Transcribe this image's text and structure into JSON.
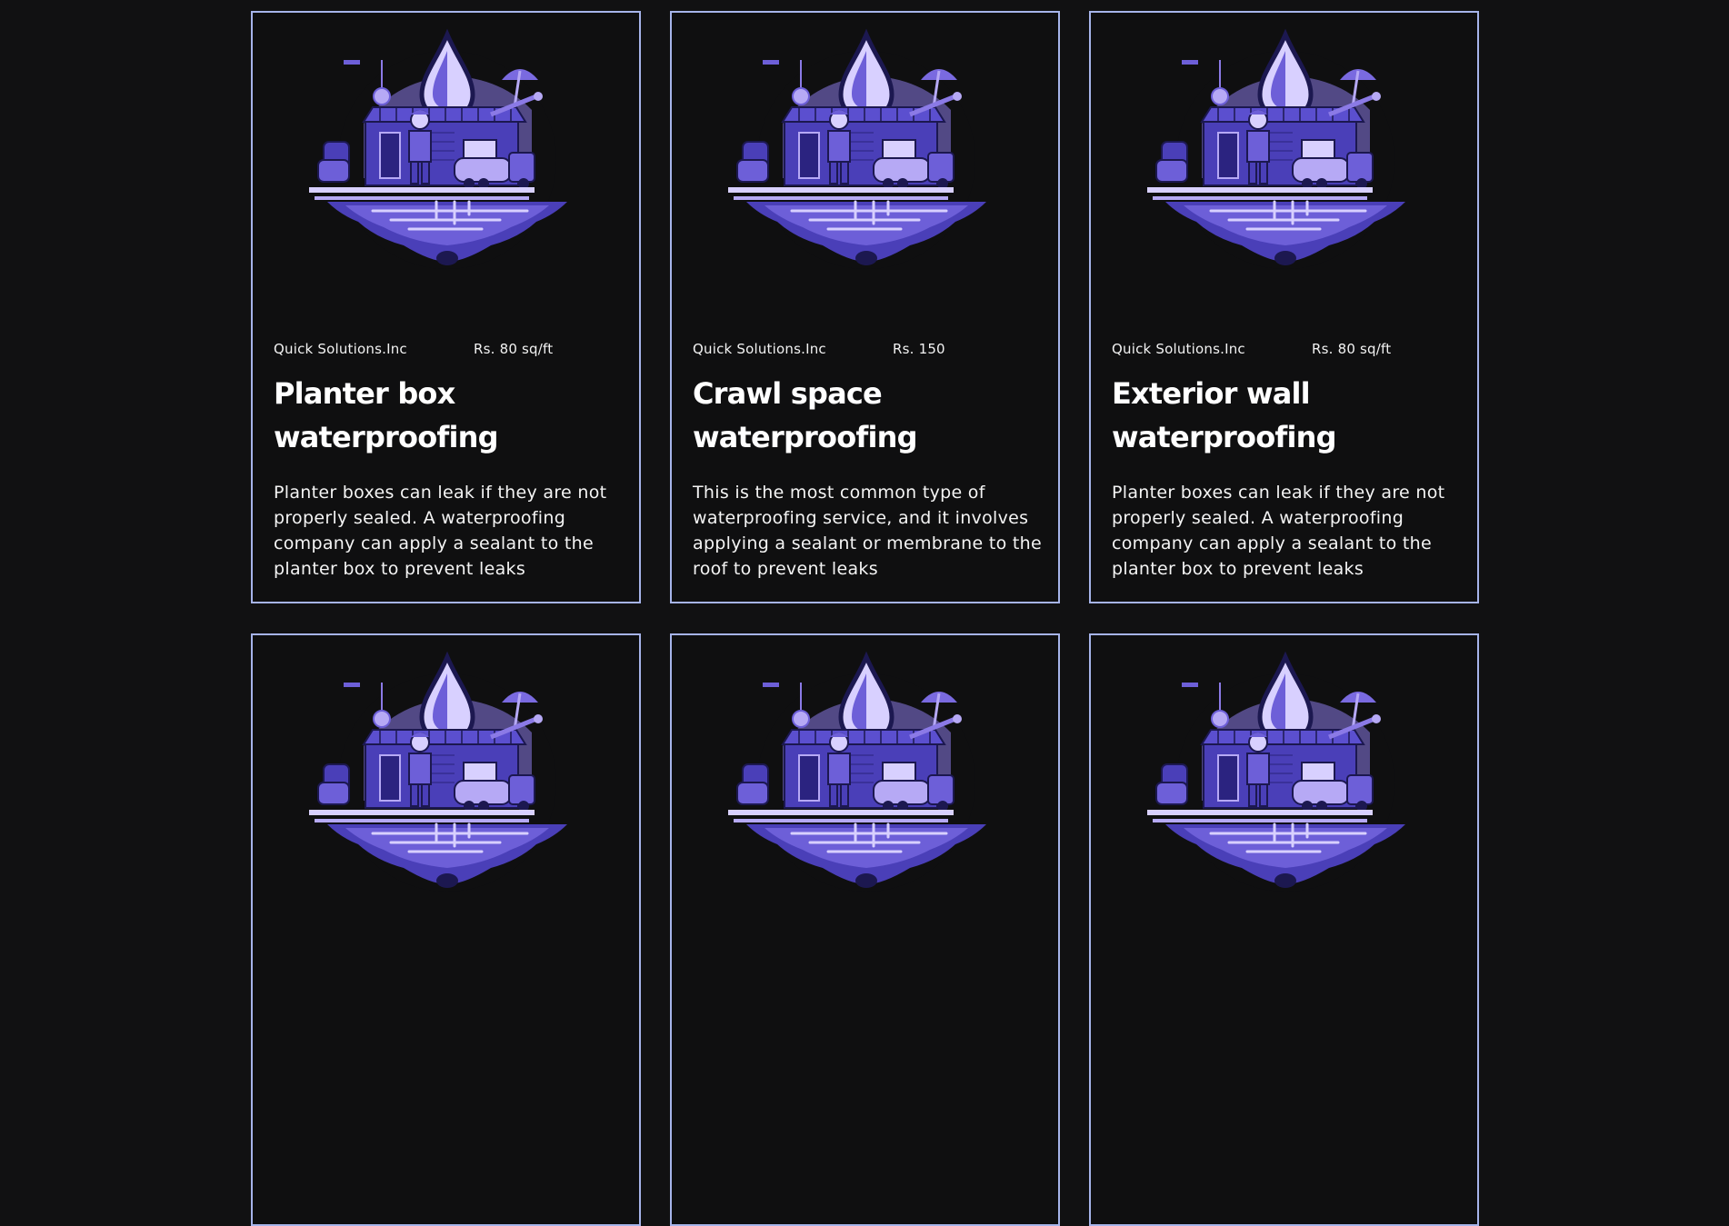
{
  "colors": {
    "background": "#111112",
    "card_border": "#a6b4ea",
    "illustration_primary": "#6d5fd8",
    "illustration_light": "#b6a9f5",
    "illustration_dark": "#1c1850"
  },
  "illustration_icon": "waterproofing-house-icon",
  "cards": [
    {
      "company": "Quick Solutions.Inc",
      "price": "Rs. 80 sq/ft",
      "title": "Planter box waterproofing",
      "description": "Planter boxes can leak if they are not properly sealed. A waterproofing company can apply a sealant to the planter box to prevent leaks"
    },
    {
      "company": "Quick Solutions.Inc",
      "price": "Rs. 150",
      "title": "Crawl space waterproofing",
      "description": "This is the most common type of waterproofing service, and it involves applying a sealant or membrane to the roof to prevent leaks"
    },
    {
      "company": "Quick Solutions.Inc",
      "price": "Rs. 80 sq/ft",
      "title": "Exterior wall waterproofing",
      "description": "Planter boxes can leak if they are not properly sealed. A waterproofing company can apply a sealant to the planter box to prevent leaks"
    },
    {
      "company": "",
      "price": "",
      "title": "",
      "description": ""
    },
    {
      "company": "",
      "price": "",
      "title": "",
      "description": ""
    },
    {
      "company": "",
      "price": "",
      "title": "",
      "description": ""
    }
  ]
}
